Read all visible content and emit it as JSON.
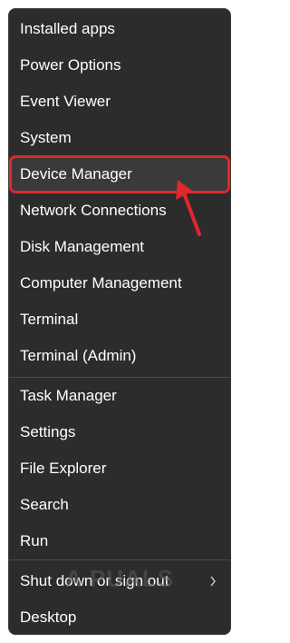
{
  "menu": {
    "items": [
      {
        "label": "Installed apps"
      },
      {
        "label": "Power Options"
      },
      {
        "label": "Event Viewer"
      },
      {
        "label": "System"
      },
      {
        "label": "Device Manager"
      },
      {
        "label": "Network Connections"
      },
      {
        "label": "Disk Management"
      },
      {
        "label": "Computer Management"
      },
      {
        "label": "Terminal"
      },
      {
        "label": "Terminal (Admin)"
      },
      {
        "label": "Task Manager"
      },
      {
        "label": "Settings"
      },
      {
        "label": "File Explorer"
      },
      {
        "label": "Search"
      },
      {
        "label": "Run"
      },
      {
        "label": "Shut down or sign out"
      },
      {
        "label": "Desktop"
      }
    ],
    "highlighted_item": "Device Manager",
    "submenu_chevron_icon": "chevron-right-icon"
  },
  "watermark": {
    "text": "A  PUALS"
  },
  "annotation": {
    "arrow_color": "#e0272b",
    "highlight_color": "#e0272b"
  }
}
